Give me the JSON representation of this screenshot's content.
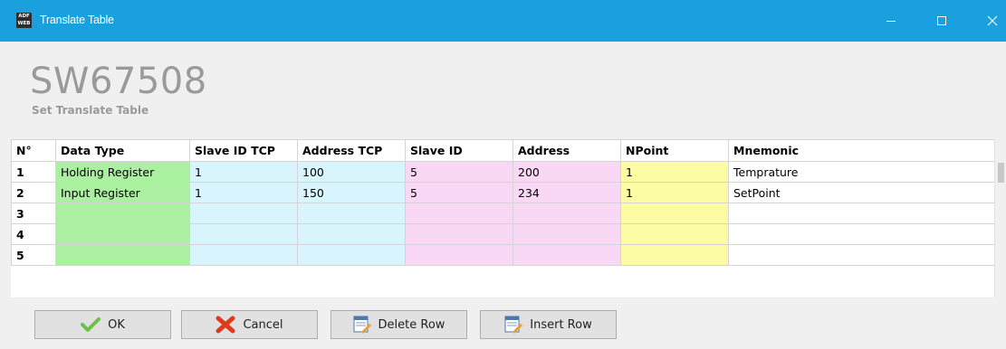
{
  "window": {
    "title": "Translate Table",
    "icon_text_top": "ADF",
    "icon_text_bottom": "WEB",
    "controls": [
      "minimize-icon",
      "maximize-icon",
      "close-icon"
    ],
    "titlebar_color": "#1aa0dc"
  },
  "header": {
    "app_name": "SW67508",
    "subtitle": "Set Translate Table"
  },
  "table": {
    "columns": [
      "N°",
      "Data Type",
      "Slave ID TCP",
      "Address TCP",
      "Slave ID",
      "Address",
      "NPoint",
      "Mnemonic"
    ],
    "column_colors": {
      "data_type": "#aaf0a0",
      "tcp": "#d8f4fc",
      "slave": "#f8d8f4",
      "npoint": "#fcfca4"
    },
    "rows": [
      {
        "num": "1",
        "data_type": "Holding Register",
        "slave_id_tcp": "1",
        "address_tcp": "100",
        "slave_id": "5",
        "address": "200",
        "npoint": "1",
        "mnemonic": "Temprature"
      },
      {
        "num": "2",
        "data_type": "Input Register",
        "slave_id_tcp": "1",
        "address_tcp": "150",
        "slave_id": "5",
        "address": "234",
        "npoint": "1",
        "mnemonic": "SetPoint"
      },
      {
        "num": "3",
        "data_type": "",
        "slave_id_tcp": "",
        "address_tcp": "",
        "slave_id": "",
        "address": "",
        "npoint": "",
        "mnemonic": ""
      },
      {
        "num": "4",
        "data_type": "",
        "slave_id_tcp": "",
        "address_tcp": "",
        "slave_id": "",
        "address": "",
        "npoint": "",
        "mnemonic": ""
      },
      {
        "num": "5",
        "data_type": "",
        "slave_id_tcp": "",
        "address_tcp": "",
        "slave_id": "",
        "address": "",
        "npoint": "",
        "mnemonic": ""
      }
    ]
  },
  "buttons": {
    "ok": {
      "label": "OK",
      "icon": "checkmark-icon"
    },
    "cancel": {
      "label": "Cancel",
      "icon": "x-icon"
    },
    "delete_row": {
      "label": "Delete Row",
      "icon": "delete-row-icon"
    },
    "insert_row": {
      "label": "Insert Row",
      "icon": "insert-row-icon"
    }
  }
}
